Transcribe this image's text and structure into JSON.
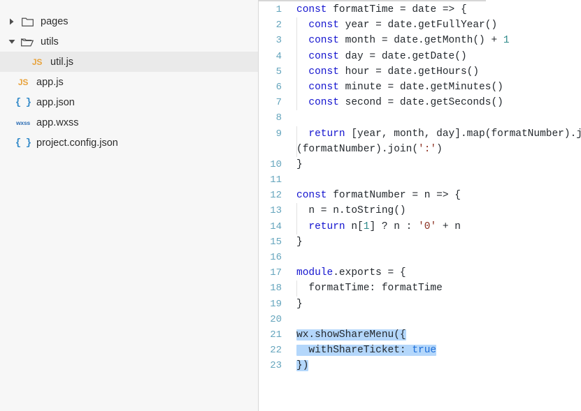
{
  "sidebar": {
    "name": "file-explorer",
    "items": [
      {
        "label": "pages",
        "kind": "folder",
        "icon": "folder-closed-icon",
        "depth": 0,
        "expanded": false,
        "selected": false,
        "twisty": "collapsed"
      },
      {
        "label": "utils",
        "kind": "folder",
        "icon": "folder-open-icon",
        "depth": 0,
        "expanded": true,
        "selected": false,
        "twisty": "expanded"
      },
      {
        "label": "util.js",
        "kind": "file-js",
        "icon": "js-file-icon",
        "depth": 1,
        "expanded": false,
        "selected": true,
        "twisty": "none"
      },
      {
        "label": "app.js",
        "kind": "file-js",
        "icon": "js-file-icon",
        "depth": 0,
        "expanded": false,
        "selected": false,
        "twisty": "none"
      },
      {
        "label": "app.json",
        "kind": "file-json",
        "icon": "json-file-icon",
        "depth": 0,
        "expanded": false,
        "selected": false,
        "twisty": "none"
      },
      {
        "label": "app.wxss",
        "kind": "file-wxss",
        "icon": "wxss-file-icon",
        "depth": 0,
        "expanded": false,
        "selected": false,
        "twisty": "none"
      },
      {
        "label": "project.config.json",
        "kind": "file-json",
        "icon": "json-file-icon",
        "depth": 0,
        "expanded": false,
        "selected": false,
        "twisty": "none"
      }
    ],
    "icon_badges": {
      "js": "JS",
      "json": "{ }",
      "wxss": "wxss"
    }
  },
  "editor": {
    "name": "code-editor",
    "language": "javascript",
    "selection_color": "#b4d7fb",
    "lines": [
      {
        "no": "1",
        "text": "const formatTime = date => {"
      },
      {
        "no": "2",
        "text": "  const year = date.getFullYear()"
      },
      {
        "no": "3",
        "text": "  const month = date.getMonth() + 1"
      },
      {
        "no": "4",
        "text": "  const day = date.getDate()"
      },
      {
        "no": "5",
        "text": "  const hour = date.getHours()"
      },
      {
        "no": "6",
        "text": "  const minute = date.getMinutes()"
      },
      {
        "no": "7",
        "text": "  const second = date.getSeconds()"
      },
      {
        "no": "8",
        "text": ""
      },
      {
        "no": "9",
        "text": "  return [year, month, day].map(formatNumber).j"
      },
      {
        "no": "",
        "text": "(formatNumber).join(':')"
      },
      {
        "no": "10",
        "text": "}"
      },
      {
        "no": "11",
        "text": ""
      },
      {
        "no": "12",
        "text": "const formatNumber = n => {"
      },
      {
        "no": "13",
        "text": "  n = n.toString()"
      },
      {
        "no": "14",
        "text": "  return n[1] ? n : '0' + n"
      },
      {
        "no": "15",
        "text": "}"
      },
      {
        "no": "16",
        "text": ""
      },
      {
        "no": "17",
        "text": "module.exports = {"
      },
      {
        "no": "18",
        "text": "  formatTime: formatTime"
      },
      {
        "no": "19",
        "text": "}"
      },
      {
        "no": "20",
        "text": ""
      },
      {
        "no": "21",
        "text": "wx.showShareMenu({"
      },
      {
        "no": "22",
        "text": "  withShareTicket: true"
      },
      {
        "no": "23",
        "text": "})"
      }
    ],
    "selected_text": "wx.showShareMenu({\n  withShareTicket: true\n})"
  }
}
